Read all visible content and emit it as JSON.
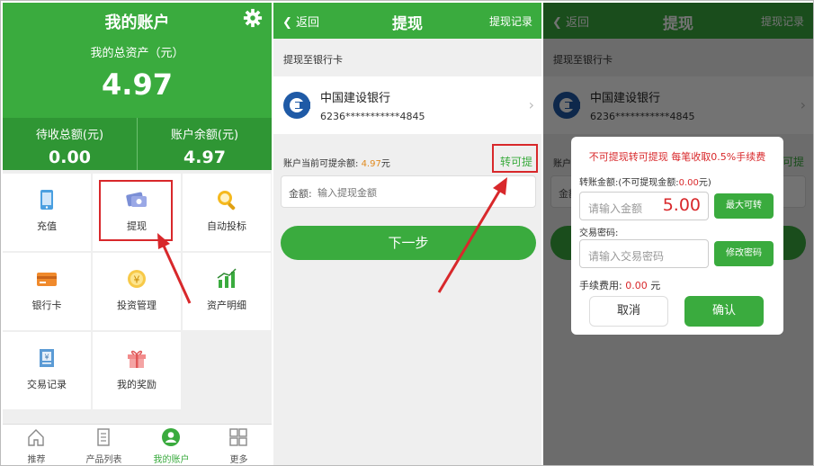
{
  "account": {
    "title": "我的账户",
    "total_asset_label": "我的总资产（元）",
    "total_asset": "4.97",
    "pending_label": "待收总额(元)",
    "pending_value": "0.00",
    "balance_label": "账户余额(元)",
    "balance_value": "4.97",
    "grid": [
      {
        "label": "充值",
        "icon": "tablet-icon"
      },
      {
        "label": "提现",
        "icon": "cash-card-icon"
      },
      {
        "label": "自动投标",
        "icon": "magnifier-icon"
      },
      {
        "label": "银行卡",
        "icon": "bank-card-icon"
      },
      {
        "label": "投资管理",
        "icon": "yen-coin-icon"
      },
      {
        "label": "资产明细",
        "icon": "bar-chart-icon"
      },
      {
        "label": "交易记录",
        "icon": "receipt-icon"
      },
      {
        "label": "我的奖励",
        "icon": "gift-icon"
      }
    ],
    "tabs": [
      {
        "label": "推荐",
        "icon": "home-icon"
      },
      {
        "label": "产品列表",
        "icon": "document-icon"
      },
      {
        "label": "我的账户",
        "icon": "user-icon"
      },
      {
        "label": "更多",
        "icon": "grid-icon"
      }
    ]
  },
  "withdraw": {
    "back_label": "返回",
    "title": "提现",
    "records_label": "提现记录",
    "section_label": "提现至银行卡",
    "bank_name": "中国建设银行",
    "bank_number": "6236***********4845",
    "available_prefix": "账户当前可提余额:",
    "available_amount": "4.97",
    "available_suffix": "元",
    "transfer_label": "转可提",
    "amount_label": "金额:",
    "amount_placeholder": "输入提现金额",
    "next_label": "下一步"
  },
  "dialog": {
    "warning": "不可提现转可提现 每笔收取0.5%手续费",
    "transfer_label_prefix": "转账金额:(不可提现金额:",
    "transfer_label_amount": "0.00",
    "transfer_label_suffix": "元)",
    "amount_placeholder": "请输入金额",
    "amount_value": "5.00",
    "max_button": "最大可转",
    "password_label": "交易密码:",
    "password_placeholder": "请输入交易密码",
    "modify_button": "修改密码",
    "fee_label": "手续费用:",
    "fee_value": "0.00",
    "fee_unit": "元",
    "cancel": "取消",
    "confirm": "确认"
  },
  "colors": {
    "brand_green": "#3aab3e",
    "highlight_red": "#d8282b",
    "orange_amount": "#e08a1e"
  }
}
